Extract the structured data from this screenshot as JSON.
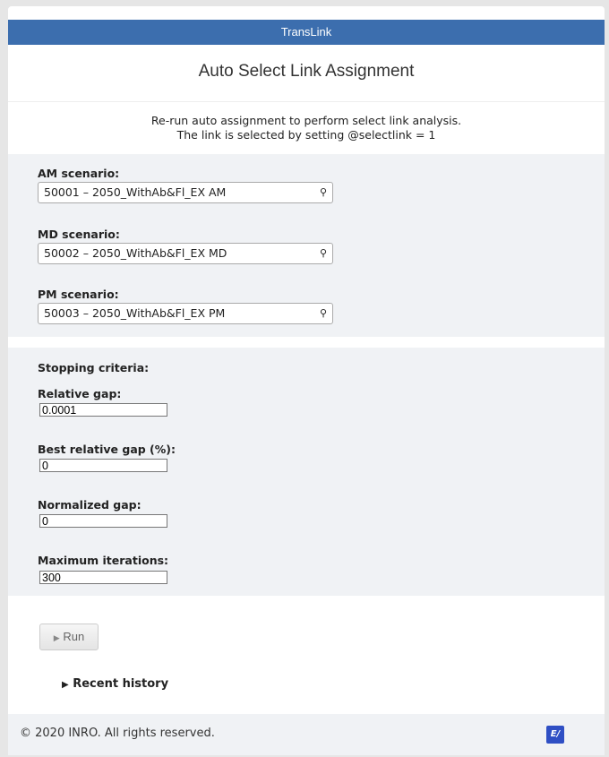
{
  "header": {
    "brand": "TransLink"
  },
  "page": {
    "title": "Auto Select Link Assignment",
    "description_line1": "Re-run auto assignment to perform select link analysis.",
    "description_line2": "The link is selected by setting @selectlink = 1"
  },
  "scenarios": [
    {
      "label": "AM scenario:",
      "value": "50001 – 2050_WithAb&Fl_EX AM"
    },
    {
      "label": "MD scenario:",
      "value": "50002 – 2050_WithAb&Fl_EX MD"
    },
    {
      "label": "PM scenario:",
      "value": "50003 – 2050_WithAb&Fl_EX PM"
    }
  ],
  "stopping": {
    "heading": "Stopping criteria:",
    "fields": [
      {
        "label": "Relative gap:",
        "value": "0.0001"
      },
      {
        "label": "Best relative gap (%):",
        "value": "0"
      },
      {
        "label": "Normalized gap:",
        "value": "0"
      },
      {
        "label": "Maximum iterations:",
        "value": "300"
      }
    ]
  },
  "run": {
    "icon": "play-icon",
    "label": "Run"
  },
  "history": {
    "label": "Recent history"
  },
  "footer": {
    "copyright": "© 2020 INRO. All rights reserved.",
    "logo": "EM"
  }
}
